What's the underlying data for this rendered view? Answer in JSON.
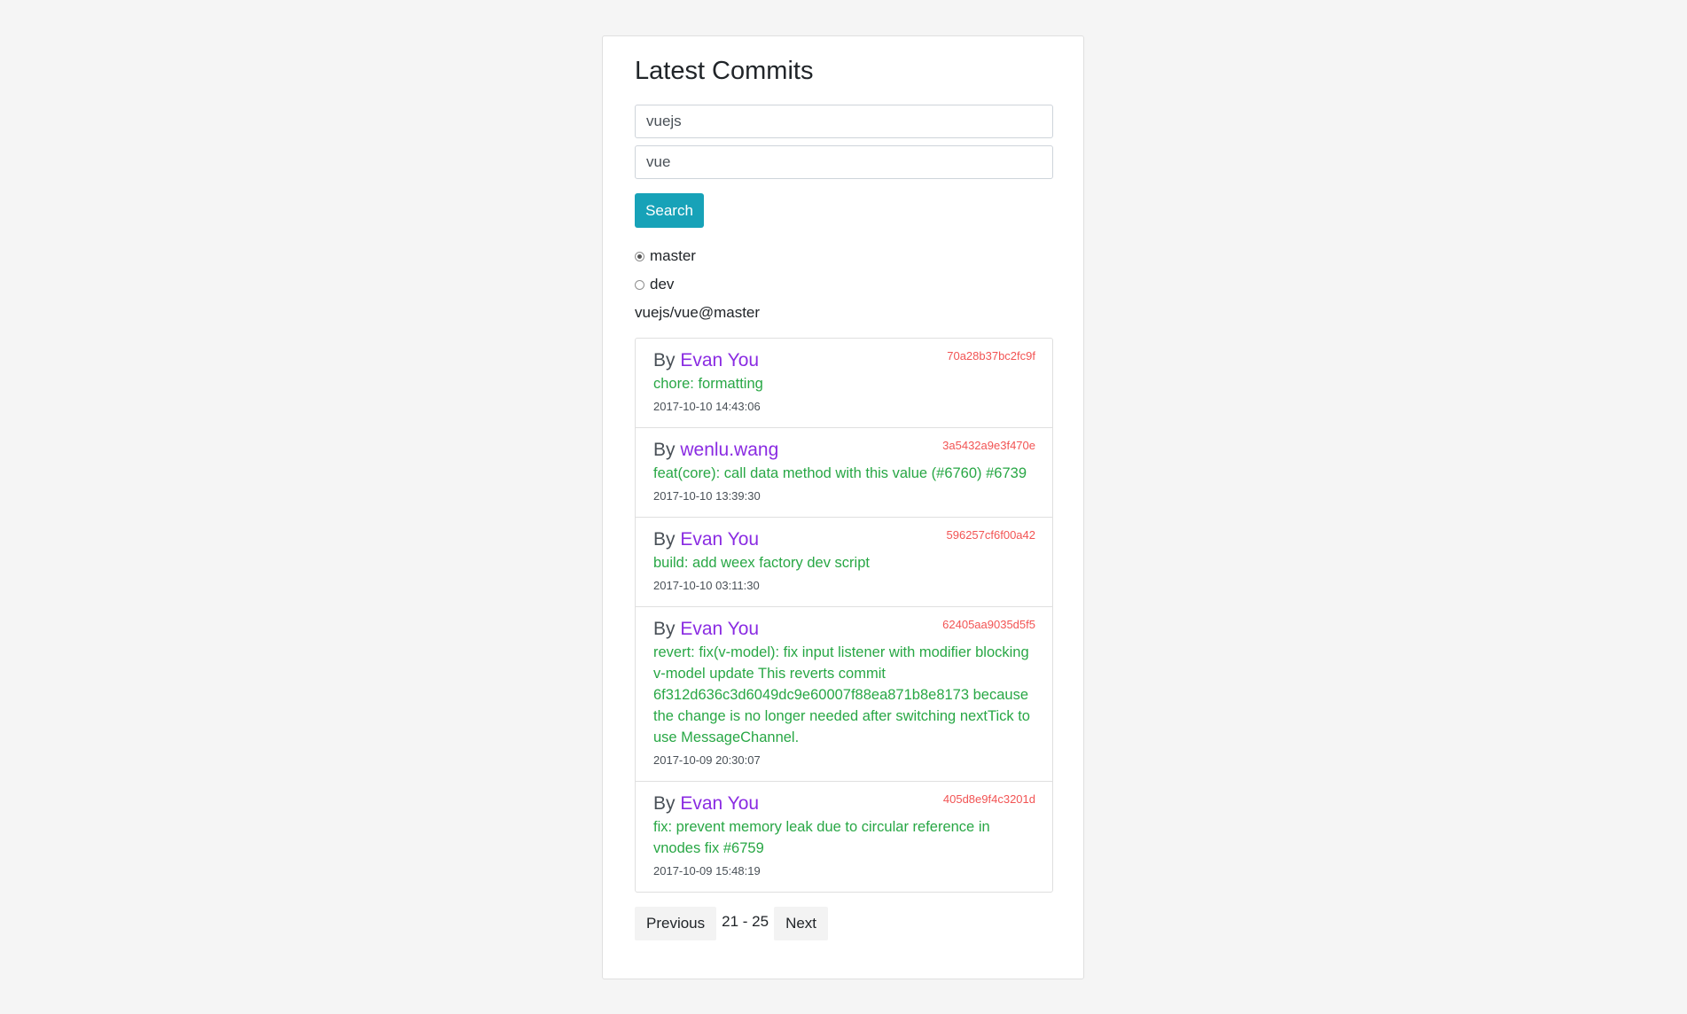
{
  "header": {
    "title": "Latest Commits"
  },
  "search": {
    "owner_value": "vuejs",
    "repo_value": "vue",
    "button_label": "Search"
  },
  "branches": {
    "options": [
      {
        "label": "master",
        "checked": true
      },
      {
        "label": "dev",
        "checked": false
      }
    ],
    "current": "vuejs/vue@master"
  },
  "commits": {
    "by_prefix": "By ",
    "items": [
      {
        "author": "Evan You",
        "sha": "70a28b37bc2fc9f",
        "message": "chore: formatting",
        "date": "2017-10-10 14:43:06"
      },
      {
        "author": "wenlu.wang",
        "sha": "3a5432a9e3f470e",
        "message": "feat(core): call data method with this value (#6760) #6739",
        "date": "2017-10-10 13:39:30"
      },
      {
        "author": "Evan You",
        "sha": "596257cf6f00a42",
        "message": "build: add weex factory dev script",
        "date": "2017-10-10 03:11:30"
      },
      {
        "author": "Evan You",
        "sha": "62405aa9035d5f5",
        "message": "revert: fix(v-model): fix input listener with modifier blocking v-model update This reverts commit 6f312d636c3d6049dc9e60007f88ea871b8e8173 because the change is no longer needed after switching nextTick to use MessageChannel.",
        "date": "2017-10-09 20:30:07"
      },
      {
        "author": "Evan You",
        "sha": "405d8e9f4c3201d",
        "message": "fix: prevent memory leak due to circular reference in vnodes fix #6759",
        "date": "2017-10-09 15:48:19"
      }
    ]
  },
  "pagination": {
    "prev_label": "Previous",
    "range": "21 - 25",
    "next_label": "Next"
  },
  "colors": {
    "accent": "#17a2b8",
    "author": "#8a2be2",
    "sha": "#f25454",
    "message": "#28a745"
  }
}
